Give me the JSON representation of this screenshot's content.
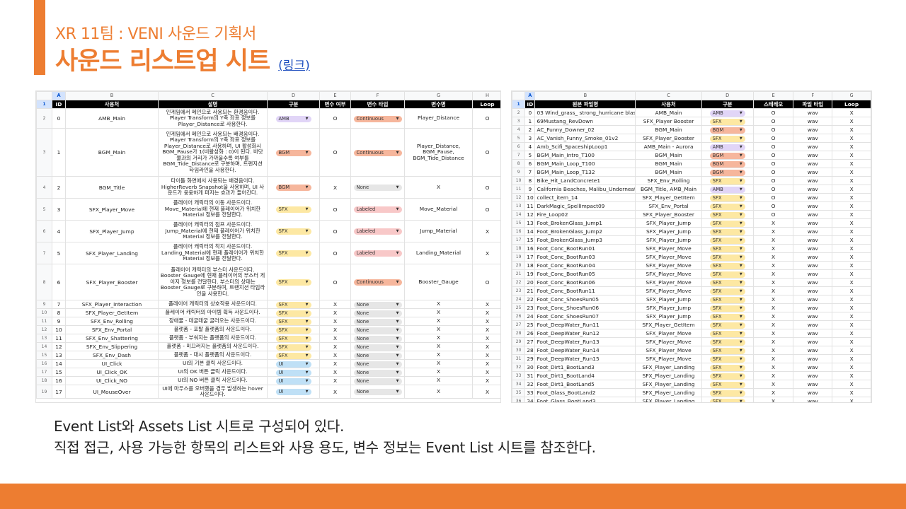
{
  "slide": {
    "subtitle": "XR 11팀 : VENI 사운드 기획서",
    "title": "사운드 리스트업 시트",
    "link": "(링크)",
    "desc1": "Event List와 Assets List 시트로 구성되어 있다.",
    "desc2": "직접 접근, 사용 가능한 항목의 리스트와 사용 용도, 변수 정보는 Event List 시트를 참조한다."
  },
  "colors": {
    "accent": "#ed7d31",
    "link": "#1f4fbf"
  },
  "event_sheet": {
    "col_letters": [
      "A",
      "B",
      "C",
      "D",
      "E",
      "F",
      "G",
      "H"
    ],
    "headers": [
      "ID",
      "사용처",
      "설명",
      "구분",
      "변수 여부",
      "변수 타입",
      "변수명",
      "Loop"
    ],
    "rows": [
      {
        "rn": "2",
        "id": "0",
        "name": "AMB_Main",
        "desc": "인게임에서 메인으로 사용되는 환경음이다. Player Transform의 Y축 좌표 정보를 Player_Distance로 사용한다.",
        "cat": "AMB",
        "var": "O",
        "type": "Continuous",
        "vname": "Player_Distance",
        "loop": "O"
      },
      {
        "rn": "3",
        "id": "1",
        "name": "BGM_Main",
        "desc": "인게임에서 메인으로 사용되는 배경음이다. Player Transform의 Y축 좌표 정보를 Player_Distance로 사용하며, UI 활성화시 BGM_Pause가 1(비활성화 : 0)이 된다. 바닷물과의 거리가 가까울수록 여부를 BGM_Tide_Distance로 구분하며, 트랜지션 타임라인을 사용한다.",
        "cat": "BGM",
        "var": "O",
        "type": "Continuous",
        "vname": "Player_Distance, BGM_Pause, BGM_Tide_Distance",
        "loop": "O"
      },
      {
        "rn": "4",
        "id": "2",
        "name": "BGM_Title",
        "desc": "타이틀 화면에서 사용되는 배경음이다. HigherReverb Snapshot을 사용하며, UI 사운드가 웅웅하게 퍼지는 효과가 들어간다.",
        "cat": "BGM",
        "var": "X",
        "type": "None",
        "vname": "X",
        "loop": "O"
      },
      {
        "rn": "5",
        "id": "3",
        "name": "SFX_Player_Move",
        "desc": "플레이어 캐릭터의 이동 사운드이다. Move_Material에 현재 플레이어가 위치한 Material 정보를 전달한다.",
        "cat": "SFX",
        "var": "O",
        "type": "Labeled",
        "vname": "Move_Material",
        "loop": "O"
      },
      {
        "rn": "6",
        "id": "4",
        "name": "SFX_Player_Jump",
        "desc": "플레이어 캐릭터의 점프 사운드이다. Jump_Material에 현재 플레이어가 위치한 Material 정보를 전달한다.",
        "cat": "SFX",
        "var": "O",
        "type": "Labeled",
        "vname": "Jump_Material",
        "loop": "X"
      },
      {
        "rn": "7",
        "id": "5",
        "name": "SFX_Player_Landing",
        "desc": "플레이어 캐릭터의 착지 사운드이다. Landing_Material에 현재 플레이어가 위치한 Material 정보를 전달한다.",
        "cat": "SFX",
        "var": "O",
        "type": "Labeled",
        "vname": "Landing_Material",
        "loop": "X"
      },
      {
        "rn": "8",
        "id": "6",
        "name": "SFX_Player_Booster",
        "desc": "플레이어 캐릭터의 부스터 사운드이다. Booster_Gauge에 현재 플레이어의 부스터 게이지 정보를 전달한다. 부스터의 상태는 Booster_Gauge로 구분하며, 트랜지션 타임라인을 사용한다.",
        "cat": "SFX",
        "var": "O",
        "type": "Continuous",
        "vname": "Booster_Gauge",
        "loop": "O"
      },
      {
        "rn": "9",
        "id": "7",
        "name": "SFX_Player_Interaction",
        "desc": "플레이어 캐릭터의 상호작용 사운드이다.",
        "cat": "SFX",
        "var": "X",
        "type": "None",
        "vname": "X",
        "loop": "X"
      },
      {
        "rn": "10",
        "id": "8",
        "name": "SFX_Player_GetItem",
        "desc": "플레이어 캐릭터의 아이템 획득 사운드이다.",
        "cat": "SFX",
        "var": "X",
        "type": "None",
        "vname": "X",
        "loop": "X"
      },
      {
        "rn": "11",
        "id": "9",
        "name": "SFX_Env_Rolling",
        "desc": "장애물 - 데굴데굴 굴러오는 사운드이다.",
        "cat": "SFX",
        "var": "X",
        "type": "None",
        "vname": "X",
        "loop": "X"
      },
      {
        "rn": "12",
        "id": "10",
        "name": "SFX_Env_Portal",
        "desc": "플랫폼 - 포탈 플랫폼의 사운드이다.",
        "cat": "SFX",
        "var": "X",
        "type": "None",
        "vname": "X",
        "loop": "X"
      },
      {
        "rn": "13",
        "id": "11",
        "name": "SFX_Env_Shattering",
        "desc": "플랫폼 - 부숴지는 플랫폼의 사운드이다.",
        "cat": "SFX",
        "var": "X",
        "type": "None",
        "vname": "X",
        "loop": "X"
      },
      {
        "rn": "14",
        "id": "12",
        "name": "SFX_Env_Slippering",
        "desc": "플랫폼 - 미끄러지는 플랫폼의 사운드이다.",
        "cat": "SFX",
        "var": "X",
        "type": "None",
        "vname": "X",
        "loop": "X"
      },
      {
        "rn": "15",
        "id": "13",
        "name": "SFX_Env_Dash",
        "desc": "플랫폼 - 대시 플랫폼의 사운드이다.",
        "cat": "SFX",
        "var": "X",
        "type": "None",
        "vname": "X",
        "loop": "X"
      },
      {
        "rn": "16",
        "id": "14",
        "name": "UI_Click",
        "desc": "UI의 기본 클릭 사운드이다.",
        "cat": "UI",
        "var": "X",
        "type": "None",
        "vname": "X",
        "loop": "X"
      },
      {
        "rn": "17",
        "id": "15",
        "name": "UI_Click_OK",
        "desc": "UI의 OK 버튼 클릭 사운드이다.",
        "cat": "UI",
        "var": "X",
        "type": "None",
        "vname": "X",
        "loop": "X"
      },
      {
        "rn": "18",
        "id": "16",
        "name": "UI_Click_NO",
        "desc": "UI의 NO 버튼 클릭 사운드이다.",
        "cat": "UI",
        "var": "X",
        "type": "None",
        "vname": "X",
        "loop": "X"
      },
      {
        "rn": "19",
        "id": "17",
        "name": "UI_MouseOver",
        "desc": "UI에 마우스를 오버했을 경우 발생하는 hover 사운드이다.",
        "cat": "UI",
        "var": "X",
        "type": "None",
        "vname": "X",
        "loop": "X"
      }
    ]
  },
  "asset_sheet": {
    "col_letters": [
      "A",
      "B",
      "C",
      "D",
      "E",
      "F",
      "G"
    ],
    "headers": [
      "ID",
      "원본 파일명",
      "사용처",
      "구분",
      "스테레오",
      "파일 타입",
      "Loop"
    ],
    "rows": [
      {
        "rn": "2",
        "id": "0",
        "file": "03 Wind_grass_ strong_hurricane blast 3",
        "use": "AMB_Main",
        "cat": "AMB",
        "st": "O",
        "ft": "wav",
        "loop": "X"
      },
      {
        "rn": "3",
        "id": "1",
        "file": "69Mustang_RevDown",
        "use": "SFX_Player Booster",
        "cat": "SFX",
        "st": "O",
        "ft": "wav",
        "loop": "X"
      },
      {
        "rn": "4",
        "id": "2",
        "file": "AC_Funny_Downer_02",
        "use": "BGM_Main",
        "cat": "BGM",
        "st": "O",
        "ft": "wav",
        "loop": "X"
      },
      {
        "rn": "5",
        "id": "3",
        "file": "AC_Vanish_Funny_Smoke_01v2",
        "use": "SFX_Player_Booster",
        "cat": "SFX",
        "st": "O",
        "ft": "wav",
        "loop": "X"
      },
      {
        "rn": "6",
        "id": "4",
        "file": "Amb_Scifi_SpaceshipLoop1",
        "use": "AMB_Main - Aurora",
        "cat": "AMB",
        "st": "O",
        "ft": "wav",
        "loop": "X"
      },
      {
        "rn": "7",
        "id": "5",
        "file": "BGM_Main_Intro_T100",
        "use": "BGM_Main",
        "cat": "BGM",
        "st": "O",
        "ft": "wav",
        "loop": "X"
      },
      {
        "rn": "8",
        "id": "6",
        "file": "BGM_Main_Loop_T100",
        "use": "BGM_Main",
        "cat": "BGM",
        "st": "O",
        "ft": "wav",
        "loop": "X"
      },
      {
        "rn": "9",
        "id": "7",
        "file": "BGM_Main_Loop_T132",
        "use": "BGM_Main",
        "cat": "BGM",
        "st": "O",
        "ft": "wav",
        "loop": "X"
      },
      {
        "rn": "10",
        "id": "8",
        "file": "Bike_Hit_LandConcrete1",
        "use": "SFX_Env_Rolling",
        "cat": "SFX",
        "st": "O",
        "ft": "wav",
        "loop": "X"
      },
      {
        "rn": "11",
        "id": "9",
        "file": "California Beaches, Malibu_Underneath Boa",
        "use": "BGM_Title, AMB_Main",
        "cat": "AMB",
        "st": "O",
        "ft": "wav",
        "loop": "X"
      },
      {
        "rn": "12",
        "id": "10",
        "file": "collect_item_14",
        "use": "SFX_Player_GetItem",
        "cat": "SFX",
        "st": "O",
        "ft": "wav",
        "loop": "X"
      },
      {
        "rn": "13",
        "id": "11",
        "file": "DarkMagic_SpellImpact09",
        "use": "SFX_Env_Portal",
        "cat": "SFX",
        "st": "O",
        "ft": "wav",
        "loop": "X"
      },
      {
        "rn": "14",
        "id": "12",
        "file": "Fire_Loop02",
        "use": "SFX_Player_Booster",
        "cat": "SFX",
        "st": "O",
        "ft": "wav",
        "loop": "X"
      },
      {
        "rn": "15",
        "id": "13",
        "file": "Foot_BrokenGlass_Jump1",
        "use": "SFX_Player_Jump",
        "cat": "SFX",
        "st": "X",
        "ft": "wav",
        "loop": "X"
      },
      {
        "rn": "16",
        "id": "14",
        "file": "Foot_BrokenGlass_Jump2",
        "use": "SFX_Player_Jump",
        "cat": "SFX",
        "st": "X",
        "ft": "wav",
        "loop": "X"
      },
      {
        "rn": "17",
        "id": "15",
        "file": "Foot_BrokenGlass_Jump3",
        "use": "SFX_Player_Jump",
        "cat": "SFX",
        "st": "X",
        "ft": "wav",
        "loop": "X"
      },
      {
        "rn": "18",
        "id": "16",
        "file": "Foot_Conc_BootRun01",
        "use": "SFX_Player_Move",
        "cat": "SFX",
        "st": "X",
        "ft": "wav",
        "loop": "X"
      },
      {
        "rn": "19",
        "id": "17",
        "file": "Foot_Conc_BootRun03",
        "use": "SFX_Player_Move",
        "cat": "SFX",
        "st": "X",
        "ft": "wav",
        "loop": "X"
      },
      {
        "rn": "20",
        "id": "18",
        "file": "Foot_Conc_BootRun04",
        "use": "SFX_Player_Move",
        "cat": "SFX",
        "st": "X",
        "ft": "wav",
        "loop": "X"
      },
      {
        "rn": "21",
        "id": "19",
        "file": "Foot_Conc_BootRun05",
        "use": "SFX_Player_Move",
        "cat": "SFX",
        "st": "X",
        "ft": "wav",
        "loop": "X"
      },
      {
        "rn": "22",
        "id": "20",
        "file": "Foot_Conc_BootRun06",
        "use": "SFX_Player_Move",
        "cat": "SFX",
        "st": "X",
        "ft": "wav",
        "loop": "X"
      },
      {
        "rn": "23",
        "id": "21",
        "file": "Foot_Conc_BootRun11",
        "use": "SFX_Player_Move",
        "cat": "SFX",
        "st": "X",
        "ft": "wav",
        "loop": "X"
      },
      {
        "rn": "24",
        "id": "22",
        "file": "Foot_Conc_ShoesRun05",
        "use": "SFX_Player_Jump",
        "cat": "SFX",
        "st": "X",
        "ft": "wav",
        "loop": "X"
      },
      {
        "rn": "25",
        "id": "23",
        "file": "Foot_Conc_ShoesRun06",
        "use": "SFX_Player_Jump",
        "cat": "SFX",
        "st": "X",
        "ft": "wav",
        "loop": "X"
      },
      {
        "rn": "26",
        "id": "24",
        "file": "Foot_Conc_ShoesRun07",
        "use": "SFX_Player_Jump",
        "cat": "SFX",
        "st": "X",
        "ft": "wav",
        "loop": "X"
      },
      {
        "rn": "27",
        "id": "25",
        "file": "Foot_DeepWater_Run11",
        "use": "SFX_Player_GetItem",
        "cat": "SFX",
        "st": "X",
        "ft": "wav",
        "loop": "X"
      },
      {
        "rn": "28",
        "id": "26",
        "file": "Foot_DeepWater_Run12",
        "use": "SFX_Player_Move",
        "cat": "SFX",
        "st": "X",
        "ft": "wav",
        "loop": "X"
      },
      {
        "rn": "29",
        "id": "27",
        "file": "Foot_DeepWater_Run13",
        "use": "SFX_Player_Move",
        "cat": "SFX",
        "st": "X",
        "ft": "wav",
        "loop": "X"
      },
      {
        "rn": "30",
        "id": "28",
        "file": "Foot_DeepWater_Run14",
        "use": "SFX_Player_Move",
        "cat": "SFX",
        "st": "X",
        "ft": "wav",
        "loop": "X"
      },
      {
        "rn": "31",
        "id": "29",
        "file": "Foot_DeepWater_Run15",
        "use": "SFX_Player_Move",
        "cat": "SFX",
        "st": "X",
        "ft": "wav",
        "loop": "X"
      },
      {
        "rn": "32",
        "id": "30",
        "file": "Foot_Dirt1_BootLand3",
        "use": "SFX_Player_Landing",
        "cat": "SFX",
        "st": "X",
        "ft": "wav",
        "loop": "X"
      },
      {
        "rn": "33",
        "id": "31",
        "file": "Foot_Dirt1_BootLand4",
        "use": "SFX_Player_Landing",
        "cat": "SFX",
        "st": "X",
        "ft": "wav",
        "loop": "X"
      },
      {
        "rn": "34",
        "id": "32",
        "file": "Foot_Dirt1_BootLand5",
        "use": "SFX_Player_Landing",
        "cat": "SFX",
        "st": "X",
        "ft": "wav",
        "loop": "X"
      },
      {
        "rn": "35",
        "id": "33",
        "file": "Foot_Glass_BootLand2",
        "use": "SFX_Player_Landing",
        "cat": "SFX",
        "st": "X",
        "ft": "wav",
        "loop": "X"
      },
      {
        "rn": "36",
        "id": "34",
        "file": "Foot_Glass_BootLand3",
        "use": "SFX_Player_Landing",
        "cat": "SFX",
        "st": "X",
        "ft": "wav",
        "loop": "X"
      }
    ]
  }
}
